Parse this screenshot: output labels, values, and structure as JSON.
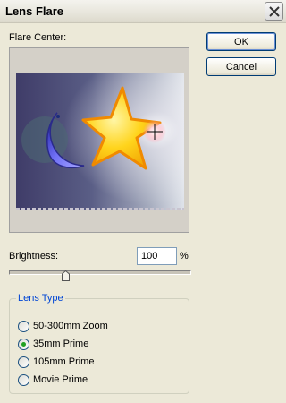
{
  "window": {
    "title": "Lens Flare"
  },
  "preview": {
    "label": "Flare Center:"
  },
  "buttons": {
    "ok": "OK",
    "cancel": "Cancel"
  },
  "brightness": {
    "label": "Brightness:",
    "value": "100",
    "unit": "%",
    "level": 100
  },
  "lens_type": {
    "title": "Lens Type",
    "options": [
      "50-300mm Zoom",
      "35mm Prime",
      "105mm Prime",
      "Movie Prime"
    ],
    "selected": "35mm Prime"
  },
  "colors": {
    "group_title": "#0046d5",
    "radio_dot": "#21a121"
  },
  "icons": [
    "close-icon",
    "crosshair-icon",
    "slider-thumb-icon"
  ]
}
